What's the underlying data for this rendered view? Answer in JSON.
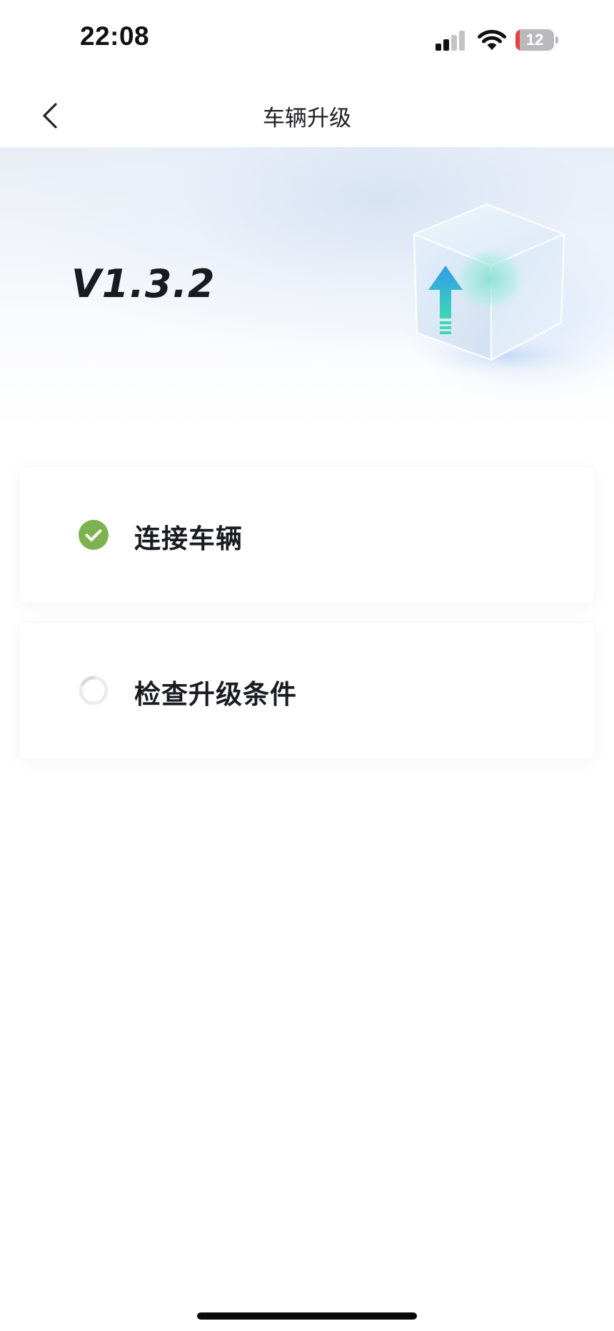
{
  "status_bar": {
    "time": "22:08",
    "signal_icon": "cellular-signal-icon",
    "wifi_icon": "wifi-icon",
    "battery_level": "12",
    "battery_color": "#e5403a"
  },
  "nav": {
    "back_icon": "chevron-left-icon",
    "title": "车辆升级"
  },
  "hero": {
    "version": "V1.3.2",
    "illustration_icon": "upgrade-cube-icon"
  },
  "steps": [
    {
      "label": "连接车辆",
      "status": "completed",
      "icon": "check-circle-icon",
      "color": "#7cb24f"
    },
    {
      "label": "检查升级条件",
      "status": "in-progress",
      "icon": "loading-spinner-icon",
      "color": "#e6e6e6"
    }
  ]
}
